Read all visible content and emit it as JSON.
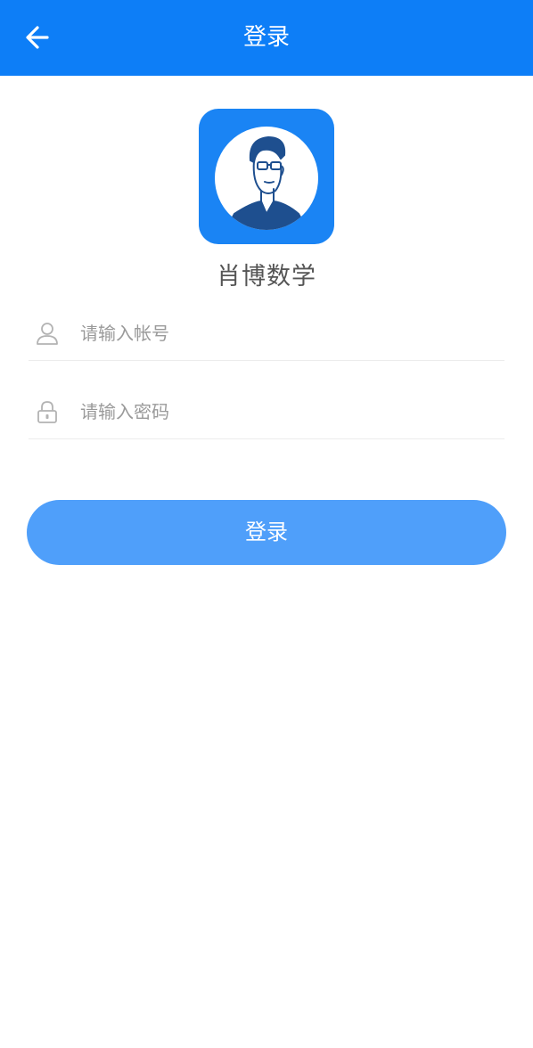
{
  "header": {
    "title": "登录",
    "back_icon": "arrow-left-icon",
    "background_color": "#0d7ef7"
  },
  "logo": {
    "icon": "teacher-portrait-icon",
    "background_color": "#1a84f4"
  },
  "app_name": "肖博数学",
  "form": {
    "account": {
      "icon": "user-icon",
      "placeholder": "请输入帐号",
      "value": ""
    },
    "password": {
      "icon": "lock-icon",
      "placeholder": "请输入密码",
      "value": ""
    }
  },
  "login_button": {
    "label": "登录",
    "color": "#4f9ffa"
  }
}
